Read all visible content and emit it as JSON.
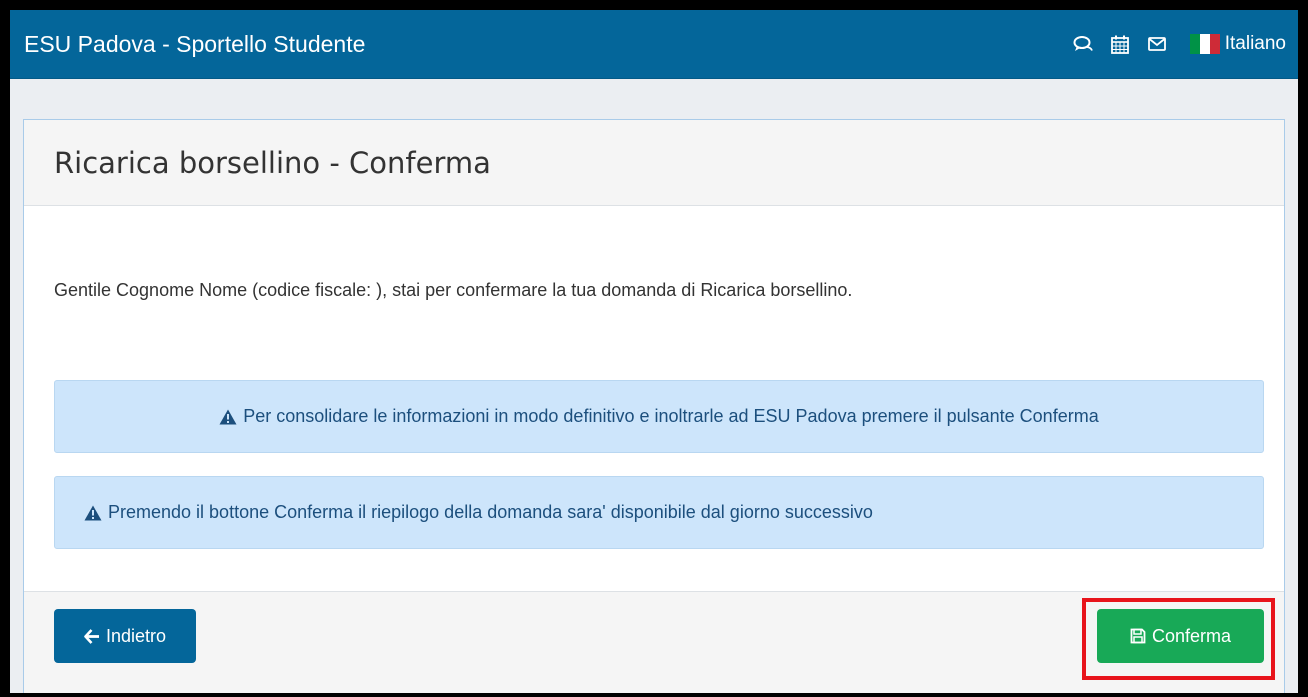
{
  "navbar": {
    "brand": "ESU Padova - Sportello Studente",
    "icons": [
      "chat-icon",
      "calendar-icon",
      "envelope-icon"
    ],
    "language": "Italiano",
    "flag_colors": [
      "#009246",
      "#ffffff",
      "#ce2b37"
    ]
  },
  "panel": {
    "title": "Ricarica borsellino - Conferma",
    "intro": "Gentile Cognome Nome (codice fiscale: ), stai per confermare la tua domanda di Ricarica borsellino.",
    "alerts": [
      "Per consolidare le informazioni in modo definitivo e inoltrarle ad ESU Padova premere il pulsante Conferma",
      "Premendo il bottone Conferma il riepilogo della domanda sara' disponibile dal giorno successivo"
    ]
  },
  "footer": {
    "back_label": "Indietro",
    "confirm_label": "Conferma"
  },
  "colors": {
    "navbar": "#04669a",
    "confirm": "#18a957",
    "alert_bg": "#cde5fb",
    "highlight": "#e8141b"
  }
}
